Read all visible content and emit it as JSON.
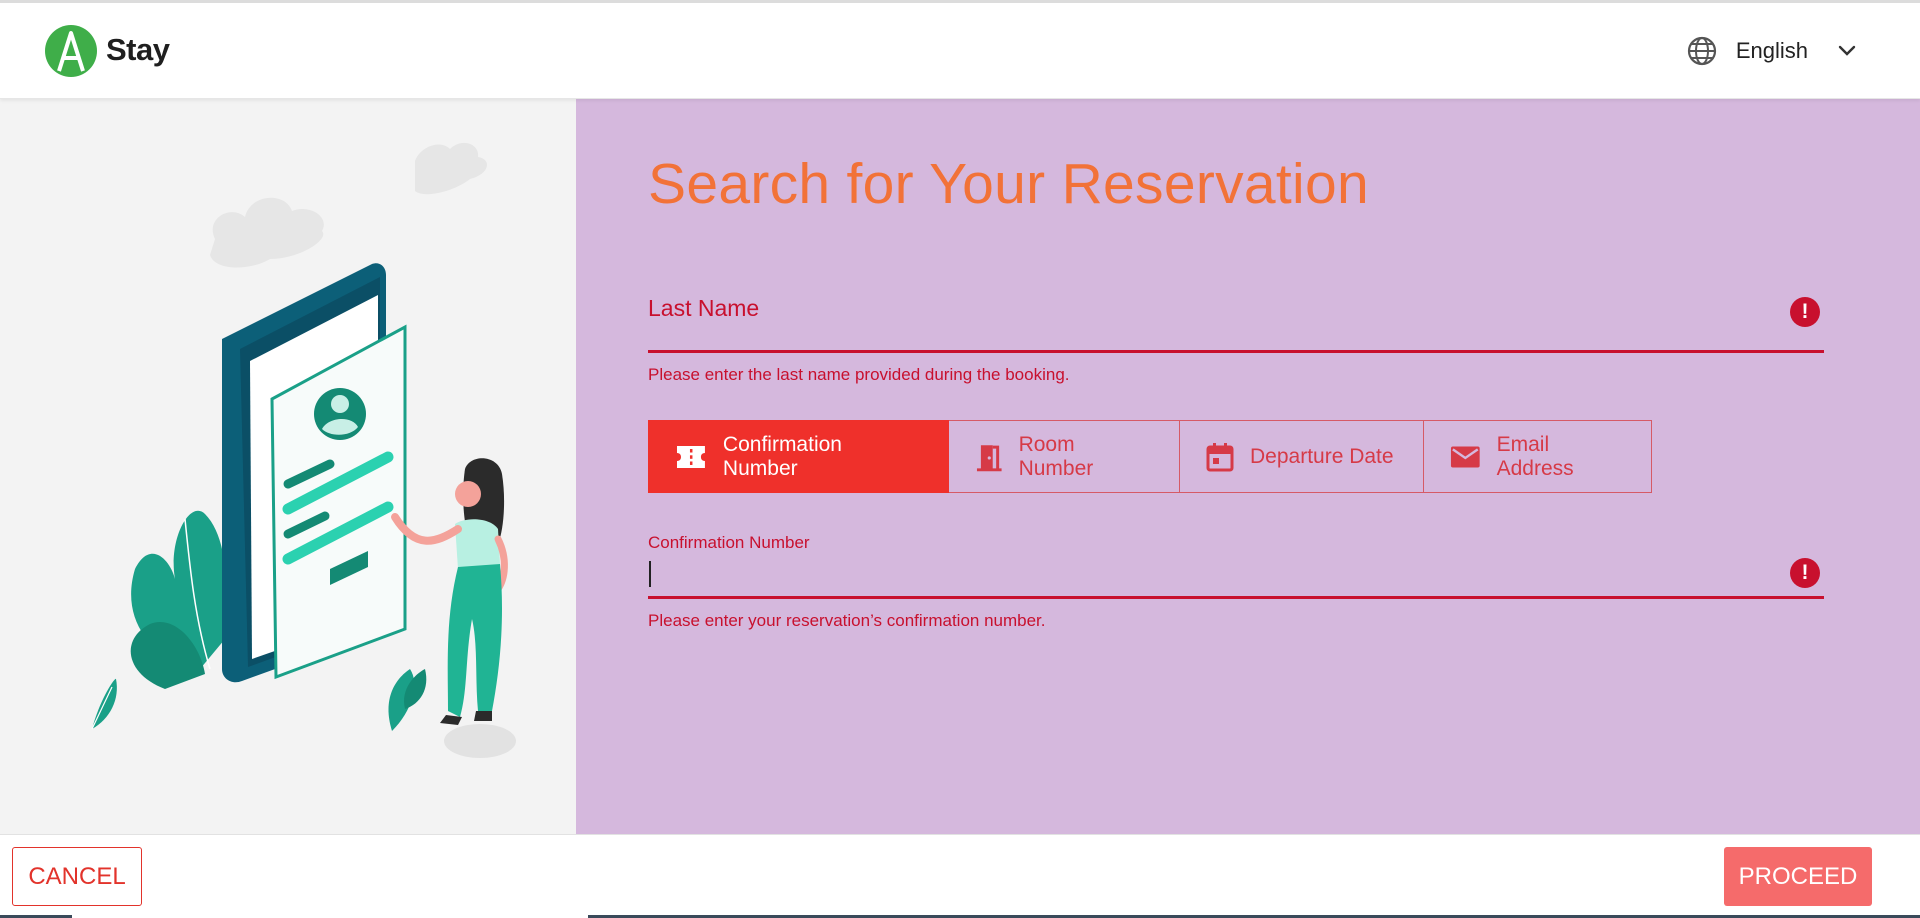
{
  "header": {
    "brand": "Stay",
    "language": "English"
  },
  "main": {
    "title": "Search for Your Reservation",
    "last_name": {
      "label": "Last Name",
      "error_icon": "exclamation-icon",
      "help": "Please enter the last name provided during the booking."
    },
    "tabs": [
      {
        "label": "Confirmation Number",
        "icon": "ticket-icon",
        "active": true
      },
      {
        "label": "Room Number",
        "icon": "door-icon",
        "active": false
      },
      {
        "label": "Departure Date",
        "icon": "calendar-icon",
        "active": false
      },
      {
        "label": "Email Address",
        "icon": "mail-icon",
        "active": false
      }
    ],
    "confirmation": {
      "label": "Confirmation Number",
      "value": "",
      "error_icon": "exclamation-icon",
      "help": "Please enter your reservation’s confirmation number."
    }
  },
  "footer": {
    "cancel_label": "CANCEL",
    "proceed_label": "PROCEED"
  },
  "colors": {
    "accent_orange": "#f27238",
    "error_red": "#c8102e",
    "tab_active": "#ef302b",
    "panel_purple": "#d5b8dd",
    "proceed": "#f56b6b",
    "logo_green": "#3fae49"
  }
}
